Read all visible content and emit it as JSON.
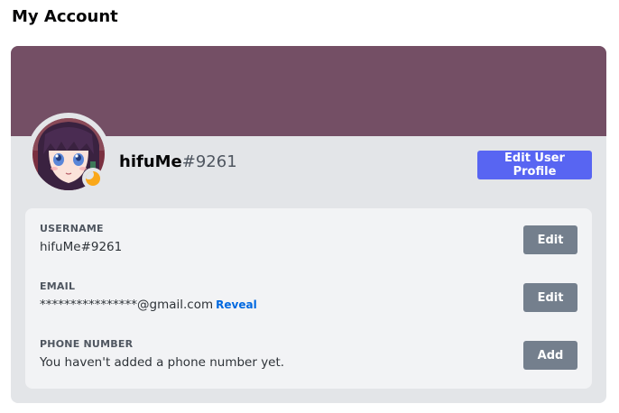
{
  "page": {
    "title": "My Account"
  },
  "profile": {
    "username": "hifuMe",
    "discriminator": "#9261",
    "banner_color": "#744f65",
    "status": "idle",
    "status_icon": "moon-icon",
    "edit_profile_label": "Edit User Profile"
  },
  "fields": {
    "username": {
      "label": "USERNAME",
      "value": "hifuMe#9261",
      "button": "Edit"
    },
    "email": {
      "label": "EMAIL",
      "value": "****************@gmail.com",
      "reveal": "Reveal",
      "button": "Edit"
    },
    "phone": {
      "label": "PHONE NUMBER",
      "value": "You haven't added a phone number yet.",
      "button": "Add"
    }
  },
  "colors": {
    "accent": "#5865f2",
    "secondary_button": "#747f8d",
    "link": "#0068e0",
    "idle": "#faa81a"
  }
}
